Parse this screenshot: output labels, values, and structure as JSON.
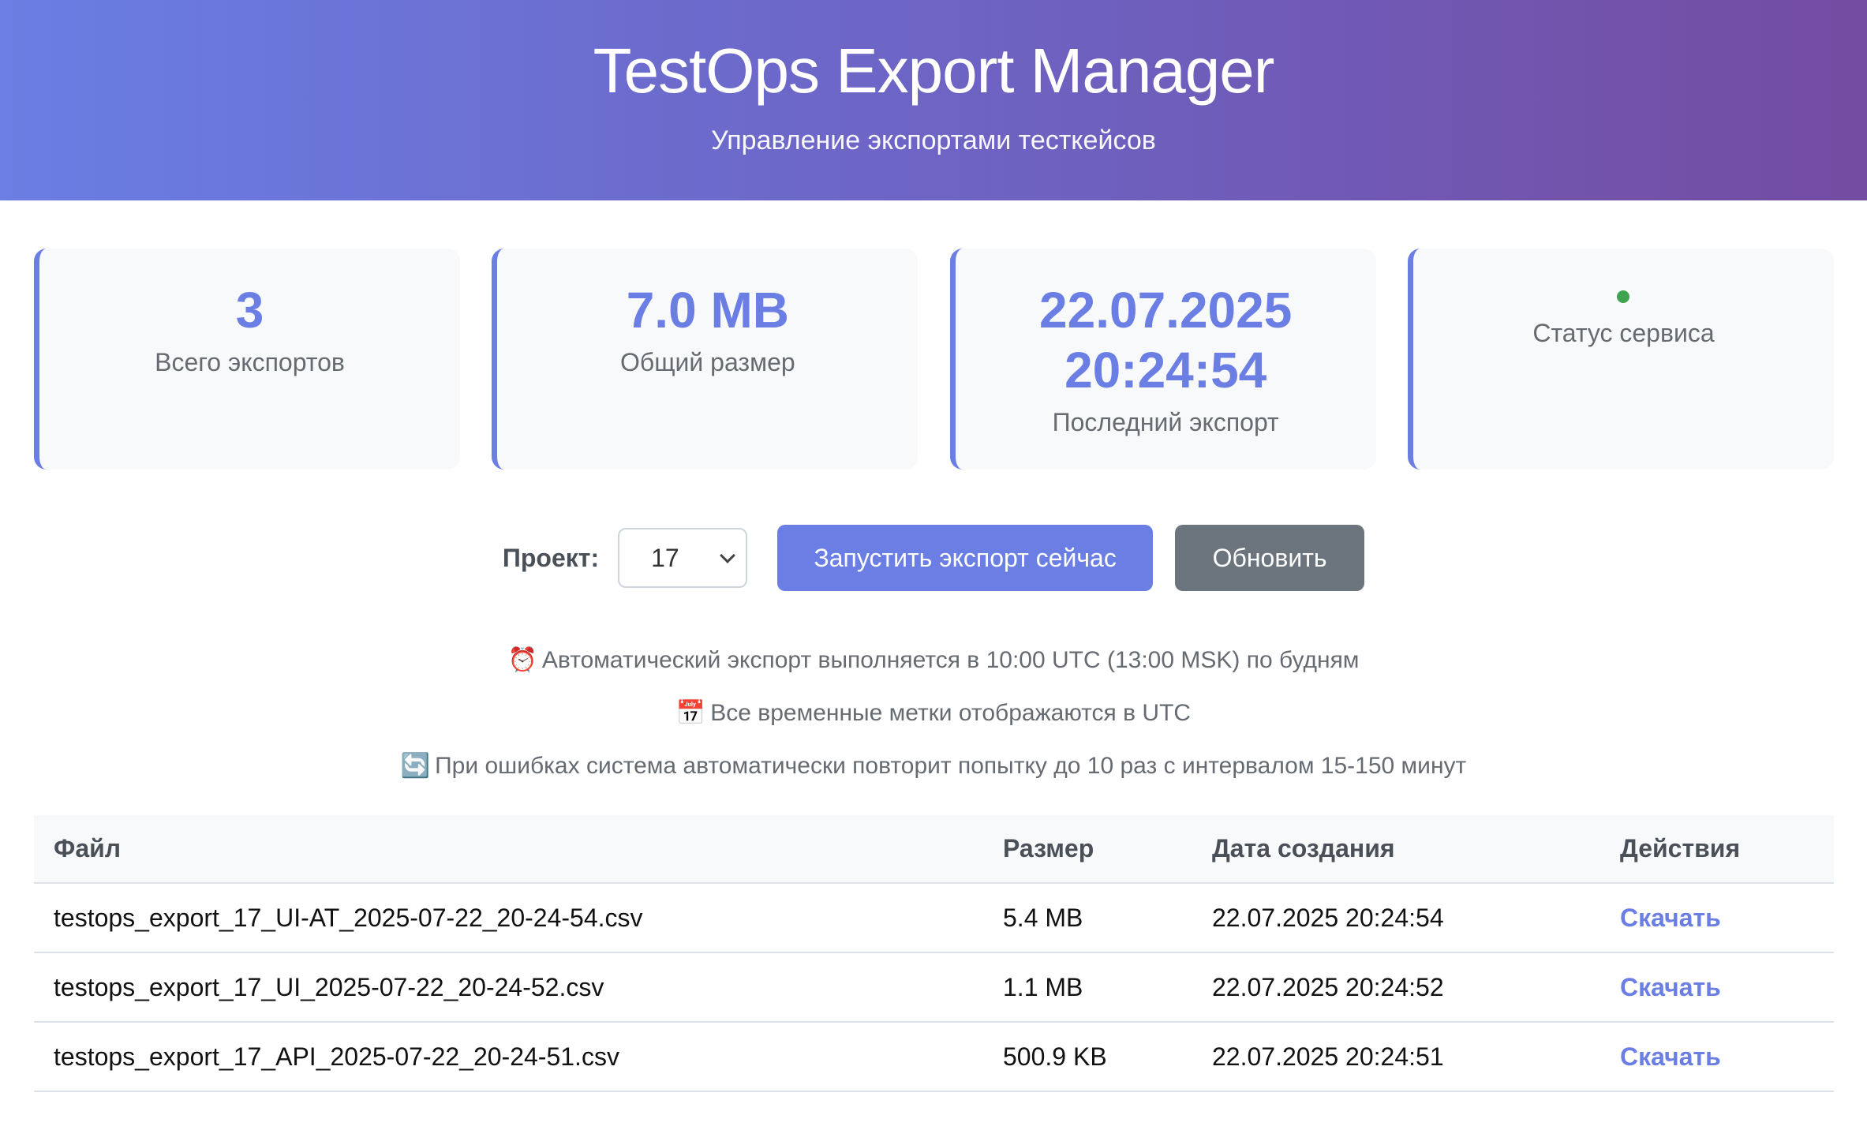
{
  "header": {
    "title": "TestOps Export Manager",
    "subtitle": "Управление экспортами тесткейсов"
  },
  "stats": [
    {
      "value": "3",
      "label": "Всего экспортов"
    },
    {
      "value": "7.0 MB",
      "label": "Общий размер"
    },
    {
      "value_line1": "22.07.2025",
      "value_line2": "20:24:54",
      "label": "Последний экспорт"
    },
    {
      "label": "Статус сервиса",
      "status_color": "#3fa34d"
    }
  ],
  "controls": {
    "project_label": "Проект:",
    "project_value": "17",
    "run_button": "Запустить экспорт сейчас",
    "refresh_button": "Обновить"
  },
  "notes": [
    {
      "icon": "alarm-clock-icon",
      "emoji": "⏰",
      "text": "Автоматический экспорт выполняется в 10:00 UTC (13:00 MSK) по будням"
    },
    {
      "icon": "calendar-icon",
      "emoji": "📅",
      "text": "Все временные метки отображаются в UTC"
    },
    {
      "icon": "refresh-icon",
      "emoji": "🔄",
      "text": "При ошибках система автоматически повторит попытку до 10 раз с интервалом 15-150 минут"
    }
  ],
  "table": {
    "headers": [
      "Файл",
      "Размер",
      "Дата создания",
      "Действия"
    ],
    "rows": [
      {
        "file": "testops_export_17_UI-AT_2025-07-22_20-24-54.csv",
        "size": "5.4 MB",
        "date": "22.07.2025 20:24:54",
        "action": "Скачать"
      },
      {
        "file": "testops_export_17_UI_2025-07-22_20-24-52.csv",
        "size": "1.1 MB",
        "date": "22.07.2025 20:24:52",
        "action": "Скачать"
      },
      {
        "file": "testops_export_17_API_2025-07-22_20-24-51.csv",
        "size": "500.9 KB",
        "date": "22.07.2025 20:24:51",
        "action": "Скачать"
      }
    ]
  },
  "colors": {
    "accent": "#6a7ee3",
    "header_gradient_start": "#6a7ee3",
    "header_gradient_end": "#744ca2",
    "secondary_button": "#6c757d",
    "status_ok": "#3fa34d"
  }
}
